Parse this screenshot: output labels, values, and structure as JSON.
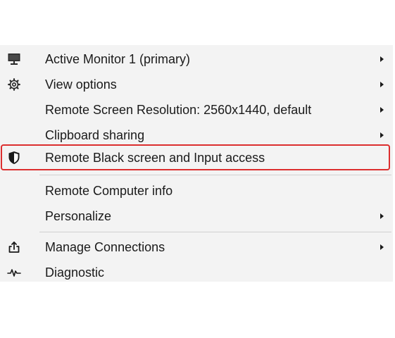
{
  "menu": {
    "items": [
      {
        "label": "Active Monitor 1 (primary)",
        "icon": "monitor-icon",
        "submenu": true
      },
      {
        "label": "View options",
        "icon": "gear-icon",
        "submenu": true
      },
      {
        "label": "Remote Screen Resolution: 2560x1440, default",
        "icon": null,
        "submenu": true
      },
      {
        "label": "Clipboard sharing",
        "icon": null,
        "submenu": true
      },
      {
        "label": "Remote Black screen and Input access",
        "icon": "shield-icon",
        "submenu": false,
        "highlighted": true
      },
      {
        "label": "Remote Computer info",
        "icon": null,
        "submenu": false
      },
      {
        "label": "Personalize",
        "icon": null,
        "submenu": true
      },
      {
        "label": "Manage Connections",
        "icon": "share-icon",
        "submenu": true
      },
      {
        "label": "Diagnostic",
        "icon": "pulse-icon",
        "submenu": false
      }
    ]
  },
  "colors": {
    "menu_bg": "#f3f3f3",
    "highlight_border": "#dc2e2e",
    "text": "#1a1a1a"
  }
}
